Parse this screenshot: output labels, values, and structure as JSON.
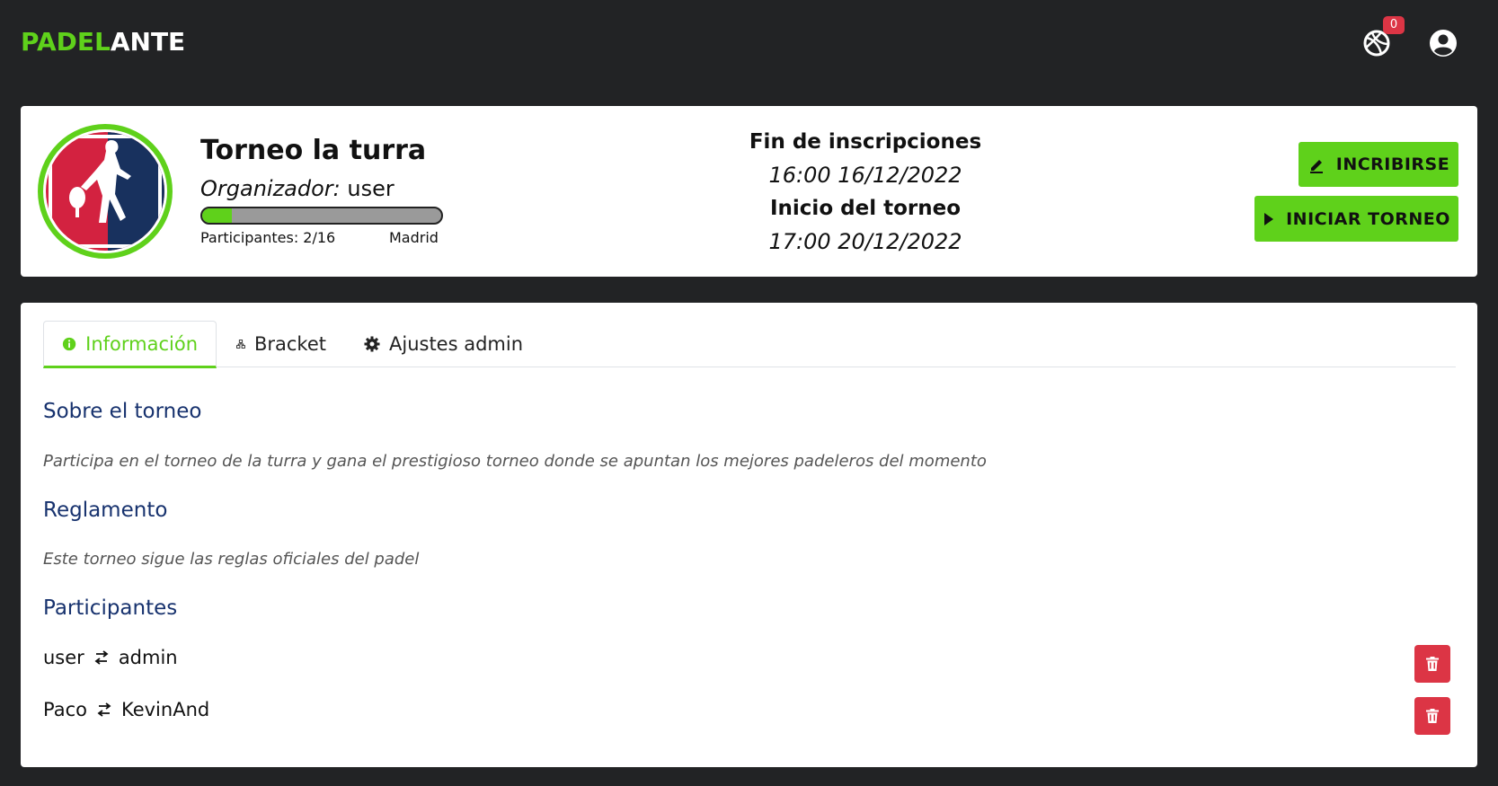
{
  "navbar": {
    "brand_part1": "PADEL",
    "brand_part2": "ANTE",
    "notification_count": "0",
    "colors": {
      "accent": "#5fd11b",
      "badge": "#dc3545",
      "background": "#222325"
    }
  },
  "tournament": {
    "title": "Torneo la turra",
    "organizer_label": "Organizador:",
    "organizer_name": "user",
    "participants_text": "Participantes: 2/16",
    "participants_fraction": 0.125,
    "location": "Madrid",
    "registration_end_label": "Fin de inscripciones",
    "registration_end_value": "16:00 16/12/2022",
    "start_label": "Inicio del torneo",
    "start_value": "17:00 20/12/2022",
    "inscribe_button": "INCRIBIRSE",
    "start_button": "INICIAR TORNEO"
  },
  "tabs": [
    {
      "label": "Información",
      "icon": "info-icon",
      "active": true
    },
    {
      "label": "Bracket",
      "icon": "bracket-icon",
      "active": false
    },
    {
      "label": "Ajustes admin",
      "icon": "gear-icon",
      "active": false
    }
  ],
  "info": {
    "about_title": "Sobre el torneo",
    "about_text": "Participa en el torneo de la turra y gana el prestigioso torneo donde se apuntan los mejores padeleros del momento",
    "rules_title": "Reglamento",
    "rules_text": "Este torneo sigue las reglas oficiales del padel",
    "participants_title": "Participantes",
    "teams": [
      {
        "player1": "user",
        "player2": "admin"
      },
      {
        "player1": "Paco",
        "player2": "KevinAnd"
      }
    ]
  }
}
